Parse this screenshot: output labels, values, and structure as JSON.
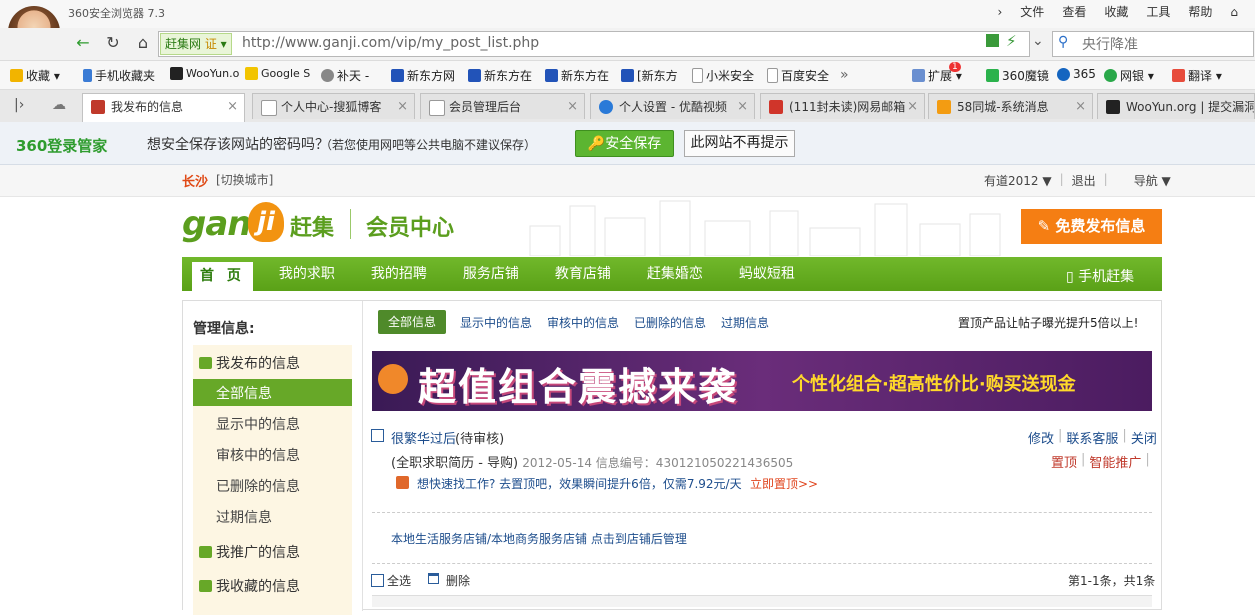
{
  "browser": {
    "title": "360安全浏览器 7.3",
    "menu": [
      "文件",
      "查看",
      "收藏",
      "工具",
      "帮助"
    ],
    "site_tag": "赶集网",
    "site_badge": "证",
    "url": "http://www.ganji.com/vip/my_post_list.php",
    "search": "央行降准",
    "bookmarks": [
      "收藏",
      "手机收藏夹",
      "WooYun.o",
      "Google S",
      "补天 -",
      "新东方网",
      "新东方在",
      "新东方在",
      "[新东方",
      "小米安全",
      "百度安全",
      "扩展",
      "360魔镜",
      "365",
      "网银",
      "翻译"
    ],
    "tabs": [
      "我发布的信息",
      "个人中心-搜狐博客",
      "会员管理后台",
      "个人设置 - 优酷视频",
      "(111封未读)网易邮箱",
      "58同城-系统消息",
      "WooYun.org | 提交漏洞"
    ],
    "extension_badge": "1"
  },
  "password_bar": {
    "logo": "360登录管家",
    "question": "想安全保存该网站的密码吗？",
    "note": "（若您使用网吧等公共电脑不建议保存）",
    "save": "安全保存",
    "never": "此网站不再提示"
  },
  "site": {
    "city": "长沙",
    "city_switch": "[切换城市]",
    "user": "有道2012 ▼",
    "logout": "退出",
    "nav_menu": "导航 ▼",
    "logo_gan": "gan",
    "logo_ji": "ji",
    "logo_cn": "赶集",
    "member_center": "会员中心",
    "post_button": "免费发布信息",
    "nav": [
      "首 页",
      "我的求职",
      "我的招聘",
      "服务店铺",
      "教育店铺",
      "赶集婚恋",
      "蚂蚁短租"
    ],
    "mobile": "手机赶集"
  },
  "sidebar": {
    "title": "管理信息:",
    "my_posts": "我发布的信息",
    "sub": [
      "全部信息",
      "显示中的信息",
      "审核中的信息",
      "已删除的信息",
      "过期信息"
    ],
    "promoted": "我推广的信息",
    "favorites": "我收藏的信息"
  },
  "main": {
    "filter_all": "全部信息",
    "filters": [
      "显示中的信息",
      "审核中的信息",
      "已删除的信息",
      "过期信息"
    ],
    "promo_note": "置顶产品让帖子曝光提升5倍以上!",
    "banner_big": "超值组合震撼来袭",
    "banner_sub": "个性化组合·超高性价比·购买送现金",
    "post": {
      "title": "很繁华过后",
      "status": "(待审核)",
      "actions": [
        "修改",
        "联系客服",
        "关闭"
      ],
      "meta_cat": "(全职求职简历 - 导购)",
      "meta_info": "2012-05-14 信息编号：430121050221436505",
      "actions2": [
        "置顶",
        "智能推广"
      ],
      "tip": "想快速找工作? 去置顶吧，效果瞬间提升6倍，仅需7.92元/天",
      "tip_link": "立即置顶>>"
    },
    "store": "本地生活服务店铺/本地商务服务店铺 点击到店铺后管理",
    "select_all": "全选",
    "delete": "删除",
    "pager": "第1-1条，共1条"
  }
}
